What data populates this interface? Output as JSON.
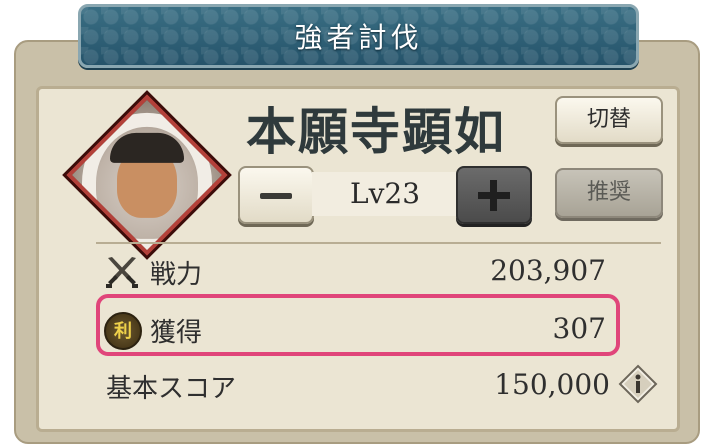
{
  "banner": {
    "title": "強者討伐"
  },
  "general": {
    "name": "本願寺顕如",
    "level": "Lv23"
  },
  "buttons": {
    "switch_label": "切替",
    "recommend_label": "推奨"
  },
  "stats": {
    "power": {
      "label": "戦力",
      "value": "203,907",
      "icon": "crossed-swords-icon"
    },
    "gain": {
      "label": "獲得",
      "value": "307",
      "icon": "coin-icon",
      "icon_glyph": "利"
    },
    "base_score": {
      "label": "基本スコア",
      "value": "150,000",
      "icon": "info-icon"
    }
  },
  "colors": {
    "highlight": "#e0457a",
    "banner": "#2f6379"
  }
}
